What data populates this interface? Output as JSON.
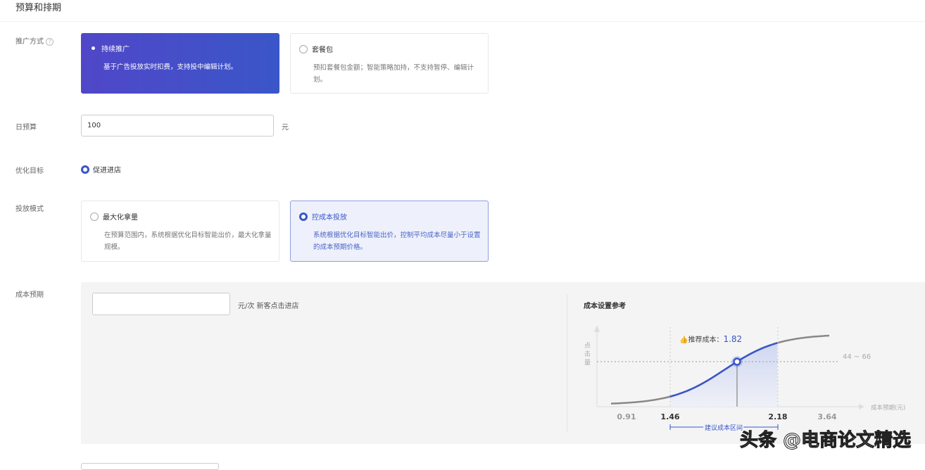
{
  "header": {
    "title": "预算和排期"
  },
  "promo": {
    "label": "推广方式",
    "options": [
      {
        "title": "持续推广",
        "desc": "基于广告投放实时扣费，支持投中编辑计划。",
        "selected": true
      },
      {
        "title": "套餐包",
        "desc": "预扣套餐包金额；智能策略加持，不支持暂停、编辑计划。",
        "selected": false
      }
    ]
  },
  "budget": {
    "label": "日预算",
    "value": "100",
    "unit": "元"
  },
  "goal": {
    "label": "优化目标",
    "option": "促进进店"
  },
  "mode": {
    "label": "投放模式",
    "options": [
      {
        "title": "最大化拿量",
        "desc": "在预算范围内，系统根据优化目标智能出价，最大化拿量规模。",
        "selected": false
      },
      {
        "title": "控成本投放",
        "desc": "系统根据优化目标智能出价，控制平均成本尽量小于设置的成本预期价格。",
        "selected": true
      }
    ]
  },
  "cost": {
    "label": "成本预期",
    "value": "",
    "unit": "元/次 新客点击进店"
  },
  "chart_data": {
    "type": "line",
    "title": "成本设置参考",
    "xlabel": "成本预期(元)",
    "ylabel": "点击量",
    "x_ticks": [
      0.91,
      1.46,
      2.18,
      3.64
    ],
    "recommended": {
      "label": "推荐成本：",
      "value": 1.82
    },
    "y_range_label": "44 ~ 66",
    "suggested_range": {
      "label": "建议成本区间",
      "min": 1.46,
      "max": 2.18
    }
  },
  "watermark": "头条 @电商论文精选"
}
